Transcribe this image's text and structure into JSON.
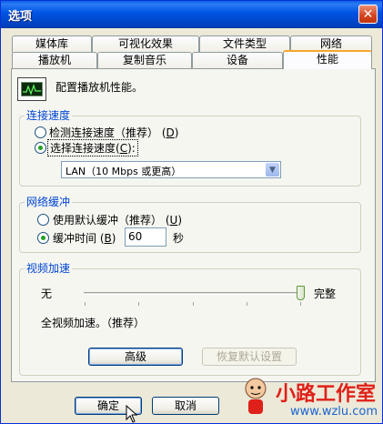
{
  "window": {
    "title": "选项"
  },
  "tabs": {
    "row1": [
      "媒体库",
      "可视化效果",
      "文件类型",
      "网络"
    ],
    "row2": [
      "播放机",
      "复制音乐",
      "设备",
      "性能"
    ],
    "active": "性能"
  },
  "performance": {
    "description": "配置播放机性能。",
    "connection": {
      "group_label": "连接速度",
      "option_detect": "检测连接速度（推荐）",
      "option_detect_key": "D",
      "option_choose": "选择连接速度",
      "option_choose_key": "C",
      "colon": ":",
      "selected_speed": "LAN（10 Mbps 或更高）"
    },
    "buffer": {
      "group_label": "网络缓冲",
      "option_default": "使用默认缓冲（推荐）",
      "option_default_key": "U",
      "option_time": "缓冲时间",
      "option_time_key": "B",
      "time_value": "60",
      "unit": "秒"
    },
    "video": {
      "group_label": "视频加速",
      "slider_min_label": "无",
      "slider_max_label": "完整",
      "slider_level": 1.0,
      "status_text": "全视频加速。（推荐）",
      "advanced_button": "高级",
      "restore_button": "恢复默认设置"
    }
  },
  "footer": {
    "ok_button": "确定",
    "cancel_button": "取消"
  },
  "watermark": {
    "text": "小路工作室",
    "url": "www.wzlu.com"
  }
}
